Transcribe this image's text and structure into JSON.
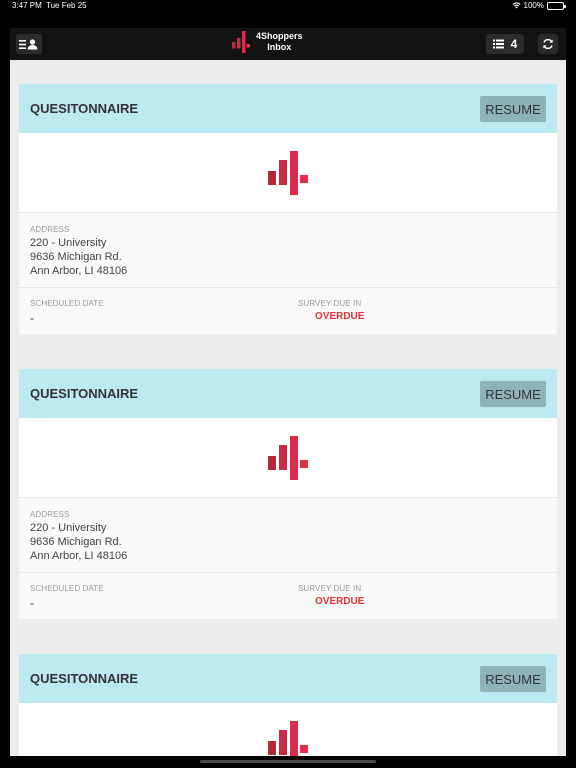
{
  "status": {
    "time": "3:47 PM",
    "date": "Tue Feb 25",
    "battery": "100%"
  },
  "nav": {
    "title_line1": "4Shoppers",
    "title_line2": "Inbox",
    "count": "4"
  },
  "colors": {
    "accent": "#e2333b",
    "header": "#bde9f0",
    "button": "#8fb4b8"
  },
  "cards": [
    {
      "title": "QUESITONNAIRE",
      "resume_label": "RESUME",
      "address_label": "ADDRESS",
      "address": [
        "220 - University",
        "9636 Michigan Rd.",
        "Ann Arbor, LI 48106"
      ],
      "scheduled_label": "SCHEDULED DATE",
      "scheduled_value": "-",
      "due_label": "SURVEY DUE IN",
      "due_value": "OVERDUE"
    },
    {
      "title": "QUESITONNAIRE",
      "resume_label": "RESUME",
      "address_label": "ADDRESS",
      "address": [
        "220 - University",
        "9636 Michigan Rd.",
        "Ann Arbor, LI 48106"
      ],
      "scheduled_label": "SCHEDULED DATE",
      "scheduled_value": "-",
      "due_label": "SURVEY DUE IN",
      "due_value": "OVERDUE"
    },
    {
      "title": "QUESITONNAIRE",
      "resume_label": "RESUME"
    }
  ]
}
